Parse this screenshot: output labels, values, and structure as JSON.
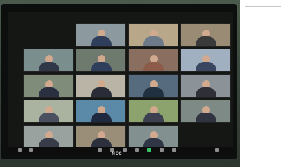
{
  "window": {
    "title": ""
  },
  "monitor": {
    "brand": "NEC"
  },
  "gallery": {
    "tiles": [
      {
        "label": "",
        "bg": "#8c9aa0",
        "shirt": "#2f3e5a"
      },
      {
        "label": "",
        "bg": "#b8a889",
        "shirt": "#6d7a8a"
      },
      {
        "label": "",
        "bg": "#9a8c74",
        "shirt": "#3a3a3a"
      },
      {
        "label": "",
        "bg": "#7a8e8e",
        "shirt": "#303848"
      },
      {
        "label": "",
        "bg": "#6f7a6e",
        "shirt": "#2f3e5a"
      },
      {
        "label": "",
        "bg": "#8a6f60",
        "shirt": "#8c5b4a"
      },
      {
        "label": "",
        "bg": "#a0b0c0",
        "shirt": "#3a4660"
      },
      {
        "label": "",
        "bg": "#7f8c7a",
        "shirt": "#2a3040"
      },
      {
        "label": "",
        "bg": "#b9b4a6",
        "shirt": "#2a2d38"
      },
      {
        "label": "",
        "bg": "#566c7e",
        "shirt": "#203040"
      },
      {
        "label": "",
        "bg": "#8b9398",
        "shirt": "#2f2f38"
      },
      {
        "label": "",
        "bg": "#a9b3a0",
        "shirt": "#4b5060"
      },
      {
        "label": "",
        "bg": "#5a8aa8",
        "shirt": "#1f2a40"
      },
      {
        "label": "",
        "bg": "#8da36e",
        "shirt": "#3c4050"
      },
      {
        "label": "",
        "bg": "#7e8a86",
        "shirt": "#2f3440"
      },
      {
        "label": "",
        "bg": "#9aa2a0",
        "shirt": "#383c48"
      },
      {
        "label": "",
        "bg": "#9a8e79",
        "shirt": "#2b303c"
      },
      {
        "label": "",
        "bg": "#829090",
        "shirt": "#303646"
      }
    ]
  },
  "colors": {
    "screen": "#151715",
    "bezel": "#0d0f0e",
    "active": "#39c46a"
  }
}
